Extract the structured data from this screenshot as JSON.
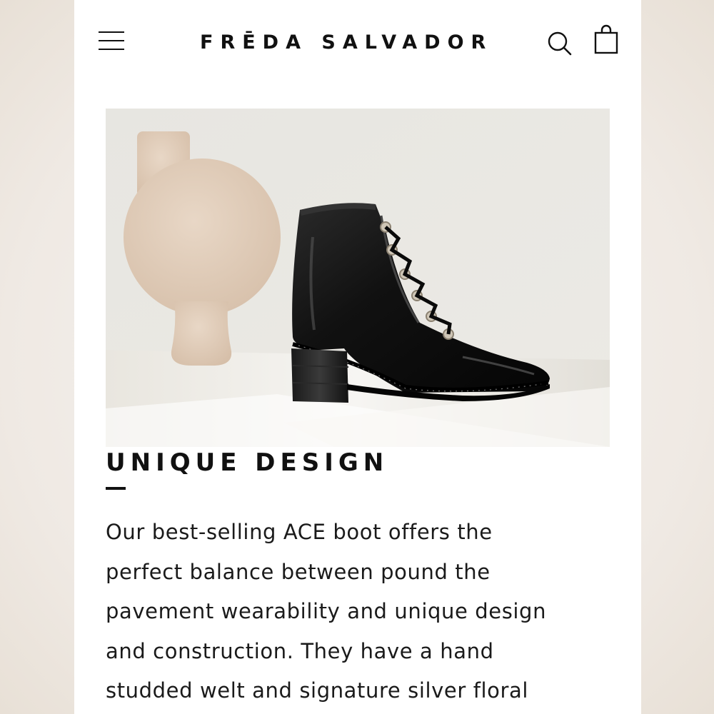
{
  "header": {
    "brand": "FRĒDA SALVADOR",
    "menu_icon": "hamburger-menu-icon",
    "search_icon": "search-icon",
    "bag_icon": "shopping-bag-icon"
  },
  "hero": {
    "image": "black lace-up leather ankle boot beside a beige ceramic vase"
  },
  "section": {
    "heading": "UNIQUE DESIGN",
    "body_lines": [
      "Our best-selling ACE boot offers the",
      "perfect balance between pound the",
      "pavement wearability and unique design",
      "and construction. They have a hand",
      "studded welt and signature silver floral"
    ]
  },
  "colors": {
    "text": "#111111",
    "background": "#ffffff"
  }
}
